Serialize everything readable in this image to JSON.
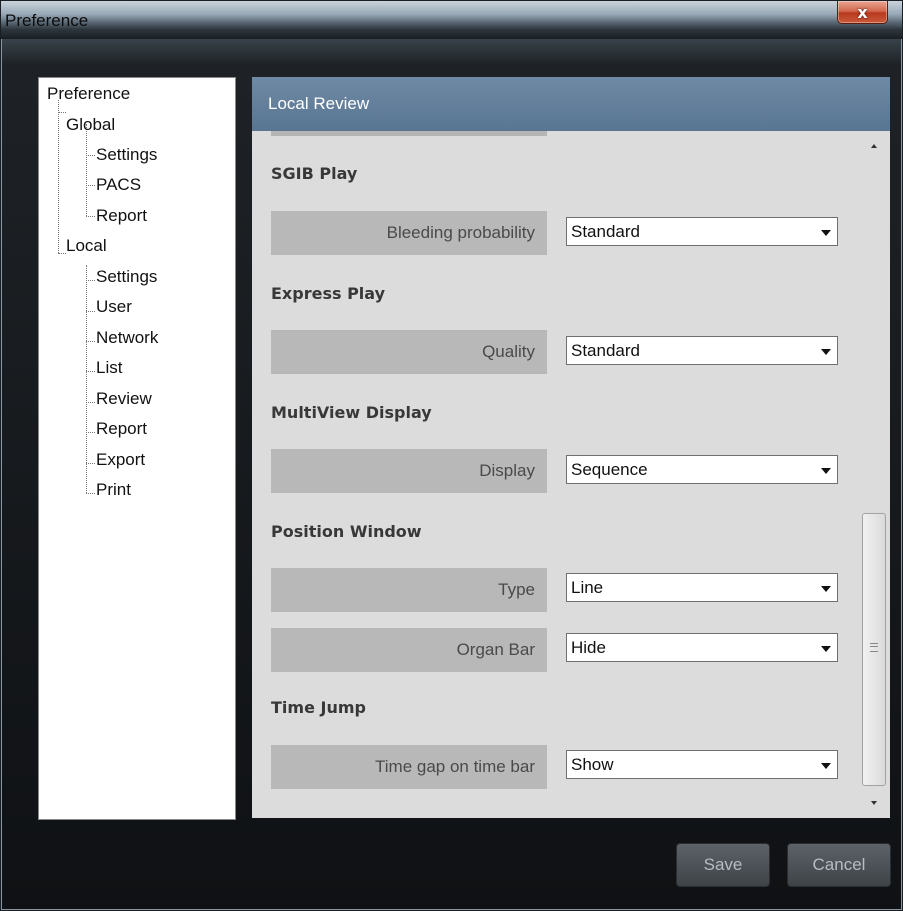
{
  "window": {
    "title": "Preference",
    "close_label": "x"
  },
  "tree": {
    "root": "Preference",
    "items": [
      {
        "label": "Global"
      },
      {
        "label": "Settings"
      },
      {
        "label": "PACS"
      },
      {
        "label": "Report"
      },
      {
        "label": "Local"
      },
      {
        "label": "Settings"
      },
      {
        "label": "User"
      },
      {
        "label": "Network"
      },
      {
        "label": "List"
      },
      {
        "label": "Review"
      },
      {
        "label": "Report"
      },
      {
        "label": "Export"
      },
      {
        "label": "Print"
      }
    ]
  },
  "panel": {
    "title": "Local Review",
    "sections": [
      {
        "title": "SGIB Play",
        "fields": [
          {
            "label": "Bleeding probability",
            "value": "Standard"
          }
        ]
      },
      {
        "title": "Express Play",
        "fields": [
          {
            "label": "Quality",
            "value": "Standard"
          }
        ]
      },
      {
        "title": "MultiView Display",
        "fields": [
          {
            "label": "Display",
            "value": "Sequence"
          }
        ]
      },
      {
        "title": "Position Window",
        "fields": [
          {
            "label": "Type",
            "value": "Line"
          },
          {
            "label": "Organ Bar",
            "value": "Hide"
          }
        ]
      },
      {
        "title": "Time Jump",
        "fields": [
          {
            "label": "Time gap on time bar",
            "value": "Show"
          }
        ]
      }
    ]
  },
  "buttons": {
    "save": "Save",
    "cancel": "Cancel"
  }
}
